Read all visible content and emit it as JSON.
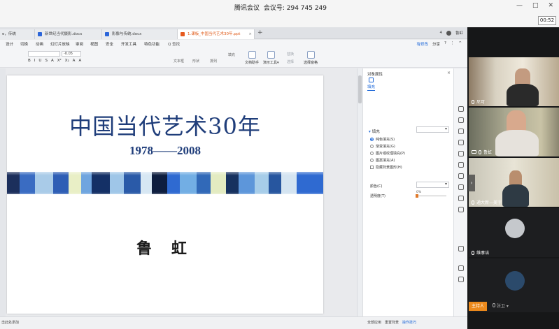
{
  "meeting": {
    "title_prefix": "腾讯会议",
    "title_id_label": "会议号: 294 745 249",
    "controls": [
      "—",
      "□",
      "✕"
    ],
    "timer": "00:52"
  },
  "wps": {
    "tabs": [
      {
        "label": "e，传统"
      },
      {
        "label": "新世纪当代摄影.docx"
      },
      {
        "label": "影像与传统.docx"
      },
      {
        "label": "1.课板_中国当代艺术30年.ppt"
      }
    ],
    "tab_add": "+",
    "user_name": "鲁虹",
    "tab_right_badge": "4",
    "menu": [
      "设计",
      "切换",
      "动画",
      "幻灯片放映",
      "审阅",
      "视图",
      "安全",
      "开发工具",
      "特色功能"
    ],
    "menu_search": "Q 查找",
    "menu_right": {
      "edit_state": "有修改",
      "share": "分享",
      "help": "?",
      "more": "⋮",
      "collapse": "^"
    },
    "font_size": "-0.05",
    "format_buttons": [
      "B",
      "I",
      "U",
      "S",
      "A",
      "X²",
      "X₂",
      "A",
      "A"
    ],
    "ribbon": {
      "textbox": "文本框",
      "shape": "形状",
      "arrange": "排列",
      "fill": "填充",
      "doc_helper": "文档助手",
      "present_tools": "演示工具",
      "present_dropdown": "▾",
      "replace": "替换",
      "select": "选择",
      "select_pane": "选择窗格"
    },
    "slide": {
      "title": "中国当代艺术30年",
      "years": "1978——2008",
      "author": "鲁 虹"
    },
    "pane": {
      "title": "对象属性",
      "tab": "填充",
      "section": "填充",
      "options": [
        "纯色填充(S)",
        "渐变填充(G)",
        "图片或纹理填充(P)",
        "图案填充(A)",
        "隐藏背景图形(H)"
      ],
      "color_label": "颜色(C)",
      "transparency_label": "透明度(T)",
      "transparency_value": "0%",
      "transparency_fraction": 0.0
    },
    "status": {
      "left": "击此处添加",
      "apply_all": "全部应用",
      "reset_bg": "重置背景",
      "tips": "操作技巧"
    }
  },
  "participants": [
    {
      "name": "尼可",
      "has_video": true
    },
    {
      "name": "鲁虹",
      "has_video": true
    },
    {
      "name": "通大新—美字",
      "has_video": true
    },
    {
      "name": "维摩诘",
      "has_video": false
    },
    {
      "name": "张卫",
      "has_video": false
    }
  ],
  "host_badge": "主持人",
  "colors": {
    "title_blue": "#1f3d7a",
    "host_orange": "#ec8a1c",
    "accent_blue": "#1a66d8",
    "active_tab_orange": "#e05a18"
  }
}
